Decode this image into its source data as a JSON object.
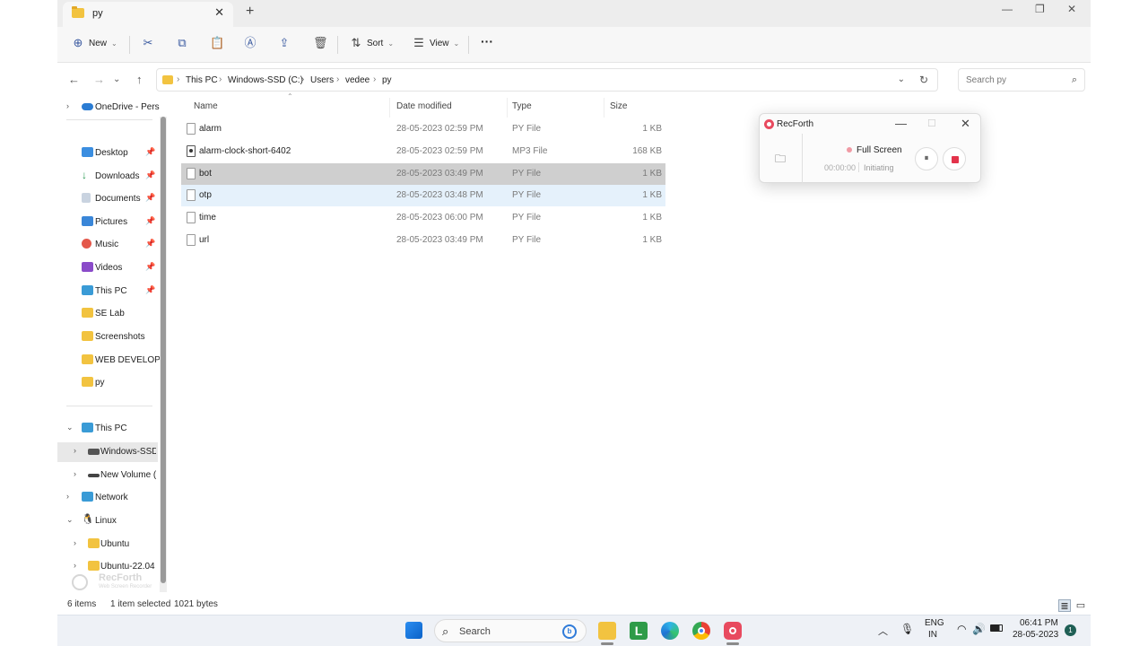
{
  "tab": {
    "title": "py"
  },
  "toolbar": {
    "new_label": "New",
    "sort_label": "Sort",
    "view_label": "View",
    "more_label": "···"
  },
  "breadcrumb": [
    "This PC",
    "Windows-SSD (C:)",
    "Users",
    "vedee",
    "py"
  ],
  "search": {
    "placeholder": "Search py"
  },
  "nav": {
    "onedrive": "OneDrive - Perso",
    "quick": [
      "Desktop",
      "Downloads",
      "Documents",
      "Pictures",
      "Music",
      "Videos",
      "This PC",
      "SE Lab",
      "Screenshots",
      "WEB DEVELOPM",
      "py"
    ],
    "this_pc": "This PC",
    "drives": [
      "Windows-SSD",
      "New Volume (D"
    ],
    "network": "Network",
    "linux": "Linux",
    "linux_items": [
      "Ubuntu",
      "Ubuntu-22.04"
    ]
  },
  "columns": {
    "name": "Name",
    "date": "Date modified",
    "type": "Type",
    "size": "Size"
  },
  "files": [
    {
      "name": "alarm",
      "date": "28-05-2023 02:59 PM",
      "type": "PY File",
      "size": "1 KB"
    },
    {
      "name": "alarm-clock-short-6402",
      "date": "28-05-2023 02:59 PM",
      "type": "MP3 File",
      "size": "168 KB"
    },
    {
      "name": "bot",
      "date": "28-05-2023 03:49 PM",
      "type": "PY File",
      "size": "1 KB"
    },
    {
      "name": "otp",
      "date": "28-05-2023 03:48 PM",
      "type": "PY File",
      "size": "1 KB"
    },
    {
      "name": "time",
      "date": "28-05-2023 06:00 PM",
      "type": "PY File",
      "size": "1 KB"
    },
    {
      "name": "url",
      "date": "28-05-2023 03:49 PM",
      "type": "PY File",
      "size": "1 KB"
    }
  ],
  "status": {
    "count": "6 items",
    "selected": "1 item selected",
    "bytes": "1021 bytes"
  },
  "recorder": {
    "title": "RecForth",
    "mode": "Full Screen",
    "time": "00:00:00",
    "state": "Initiating"
  },
  "watermark": {
    "line1": "RecForth",
    "line2": "Web Screen Recorder"
  },
  "taskbar": {
    "search_label": "Search",
    "lang1": "ENG",
    "lang2": "IN",
    "time": "06:41 PM",
    "date": "28-05-2023",
    "notif": "1"
  }
}
